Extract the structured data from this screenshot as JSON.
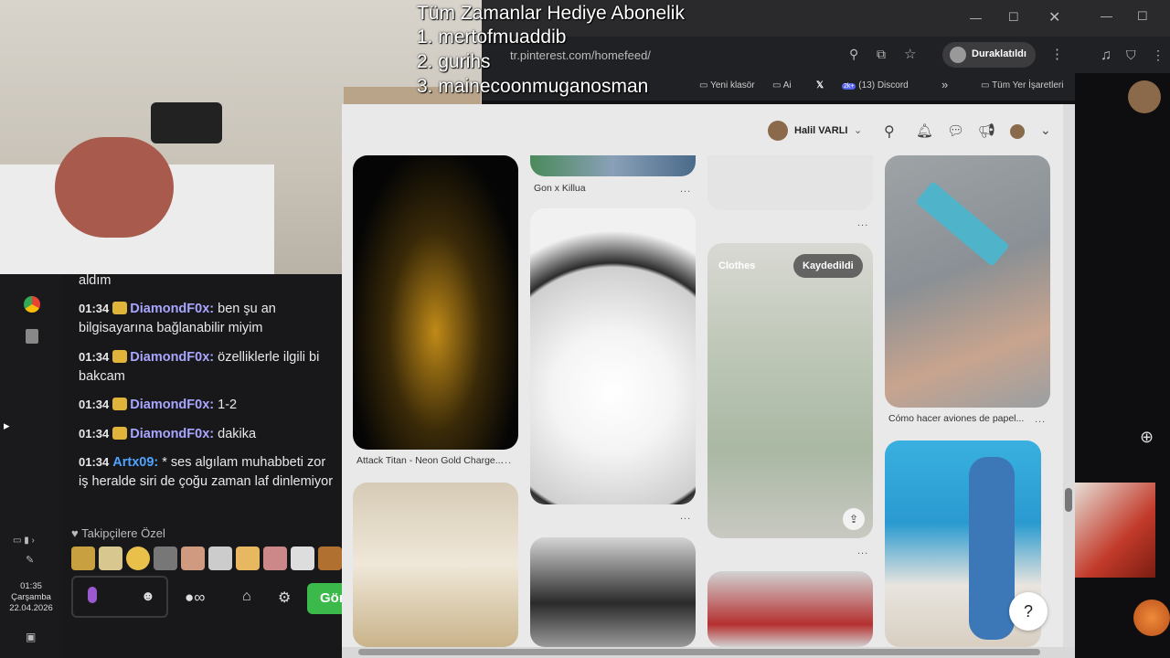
{
  "overlay": {
    "title": "Tüm Zamanlar Hediye  Abonelik",
    "rank1": "1. mertofmuaddib",
    "rank2": "2. gurihs",
    "rank3": "3. mainecoonmuganosman"
  },
  "browser": {
    "url": "tr.pinterest.com/homefeed/",
    "profile_label": "Duraklatıldı",
    "bookmarks": [
      "Yeni klasör",
      "Ai",
      "(13) Discord",
      "Tüm Yer İşaretleri"
    ],
    "user_name": "Halil VARLI"
  },
  "pins": {
    "gon_caption": "Gon x Killua",
    "attack_caption": "Attack Titan - Neon Gold Charge...",
    "plane_caption": "Cómo hacer aviones de papel...",
    "dress_board": "Clothes",
    "dress_saved": "Kaydedildi",
    "more": "..."
  },
  "chat": {
    "prev_tail": "aldım",
    "messages": [
      {
        "time": "01:34",
        "user": "DiamondF0x",
        "text": "ben şu an bilgisayarına bağlanabilir miyim",
        "color": "#a8a6ff"
      },
      {
        "time": "01:34",
        "user": "DiamondF0x",
        "text": "özelliklerle ilgili bi bakcam",
        "color": "#a8a6ff"
      },
      {
        "time": "01:34",
        "user": "DiamondF0x",
        "text": "1-2",
        "color": "#a8a6ff"
      },
      {
        "time": "01:34",
        "user": "DiamondF0x",
        "text": "dakika",
        "color": "#a8a6ff"
      },
      {
        "time": "01:34",
        "user": "Artx09",
        "text": "* ses algılam muhabbeti zor iş heralde siri de çoğu zaman laf dinlemiyor",
        "color": "#4fa3ff"
      }
    ],
    "followers_label": "Takipçilere Özel",
    "send_label": "Gön"
  },
  "taskbar": {
    "time": "01:35",
    "day": "Çarşamba",
    "date": "22.04.2026",
    "discord_badge": "2k+"
  }
}
